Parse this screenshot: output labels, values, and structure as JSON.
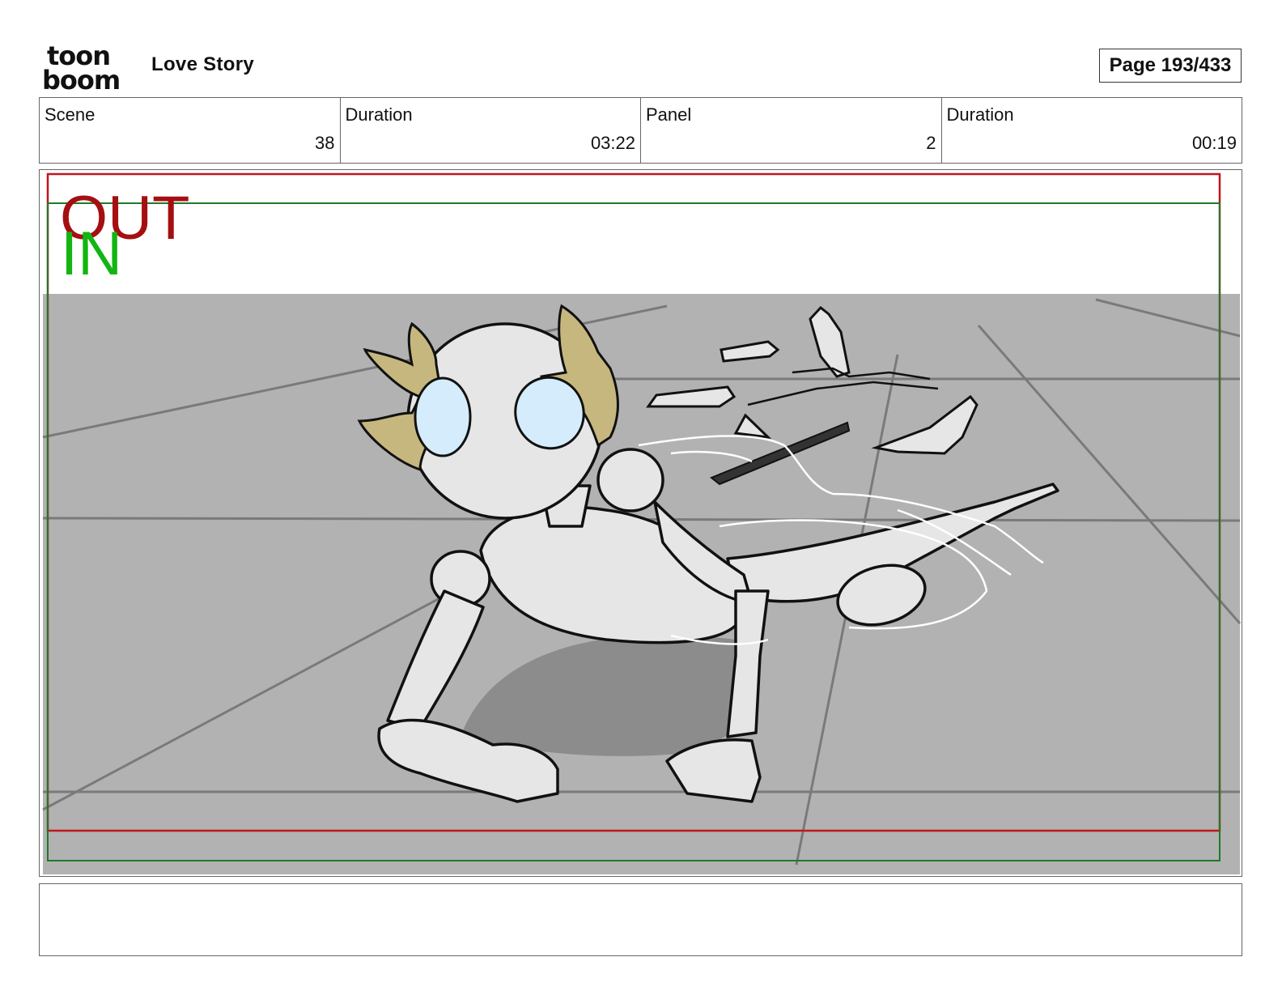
{
  "header": {
    "logo": {
      "top": "toon",
      "bottom": "boom"
    },
    "project_title": "Love Story",
    "page_label": "Page 193/433"
  },
  "info": {
    "scene_label": "Scene",
    "scene_value": "38",
    "scene_duration_label": "Duration",
    "scene_duration_value": "03:22",
    "panel_label": "Panel",
    "panel_value": "2",
    "panel_duration_label": "Duration",
    "panel_duration_value": "00:19"
  },
  "panel": {
    "out_label": "OUT",
    "in_label": "IN",
    "colors": {
      "out_frame": "#c0171b",
      "in_frame": "#1f7a2a",
      "floor": "#b2b2b2",
      "skin": "#e6e6e6",
      "hair": "#c6b77e",
      "eyes": "#d4ecfb"
    }
  },
  "caption": {
    "text": ""
  }
}
